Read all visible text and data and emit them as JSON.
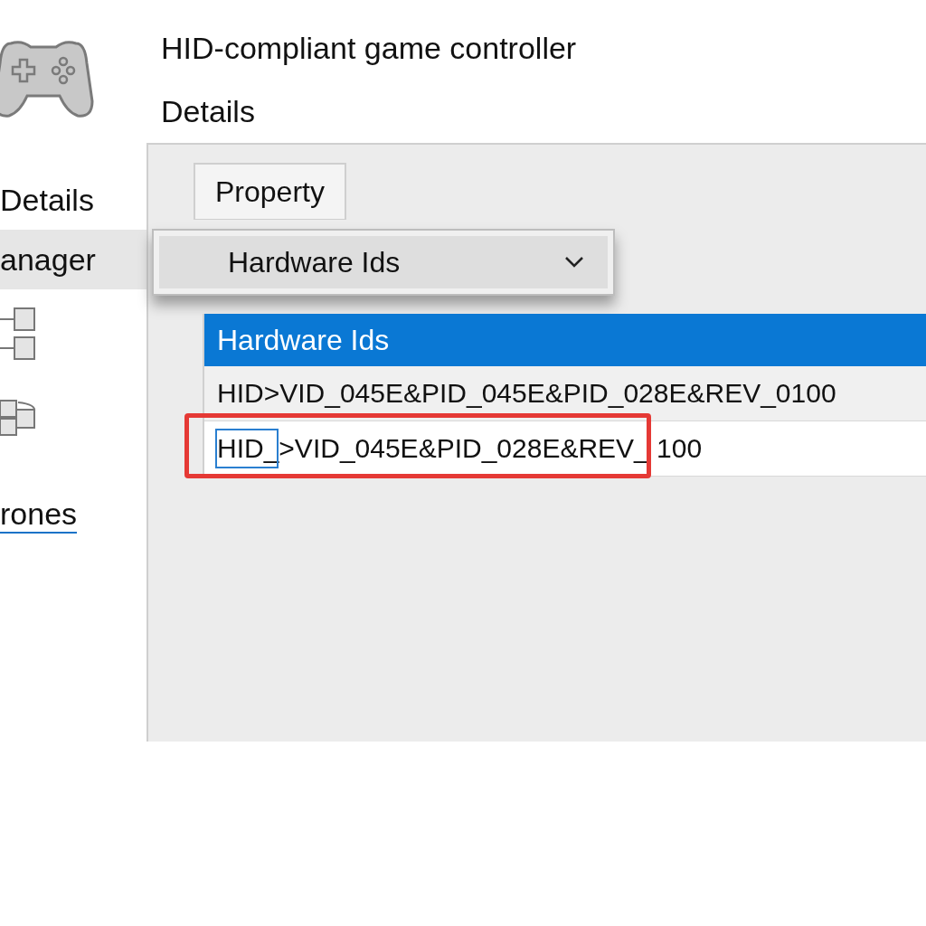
{
  "device": {
    "name": "HID-compliant game controller",
    "section": "Details"
  },
  "sidebar": {
    "items": [
      {
        "kind": "text",
        "label": "Details",
        "selected": false
      },
      {
        "kind": "text",
        "label": "anager",
        "selected": true
      },
      {
        "kind": "icon",
        "selected": false
      },
      {
        "kind": "icon",
        "selected": false
      },
      {
        "kind": "link",
        "label": "rones",
        "selected": false
      }
    ]
  },
  "tabs": [
    {
      "label": "Property",
      "selected": true
    }
  ],
  "property_dropdown": {
    "value": "Hardware Ids"
  },
  "list": {
    "header": "Hardware Ids",
    "rows": [
      {
        "text": "HID>VID_045E&PID_045E&PID_028E&REV_0100",
        "focused": false,
        "annotated": false
      },
      {
        "text": "HID_>VID_045E&PID_028E&REV_ 100",
        "focused": true,
        "annotated": true
      }
    ]
  }
}
